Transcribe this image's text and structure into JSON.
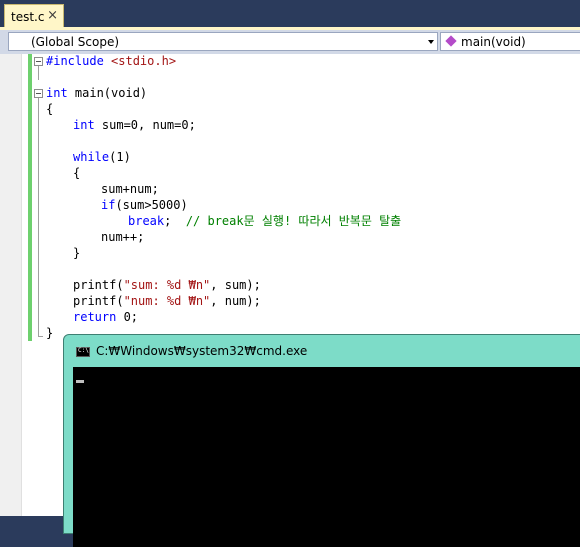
{
  "tab": {
    "label": "test.c",
    "close_glyph": "×"
  },
  "nav": {
    "scope": "(Global Scope)",
    "member": "main(void)"
  },
  "code": {
    "include_kw": "#include",
    "include_file": " <stdio.h>",
    "l4_kw": "int",
    "l4_rest": " main(void)",
    "brace_open": "{",
    "l6_kw": "int",
    "l6_rest": " sum=0, num=0;",
    "l8_kw": "while",
    "l8_rest": "(1)",
    "brace_open2": "{",
    "l10": "sum+num;",
    "l11_kw": "if",
    "l11_rest": "(sum>5000)",
    "l12_kw": "break",
    "l12_mid": ";  ",
    "l12_cmt": "// break문 실행! 따라서 반복문 탈출",
    "l13": "num++;",
    "brace_close2": "}",
    "l16_a": "printf(",
    "l16_str": "\"sum: %d ₩n\"",
    "l16_b": ", sum);",
    "l17_a": "printf(",
    "l17_str": "\"num: %d ₩n\"",
    "l17_b": ", num);",
    "l18_kw": "return",
    "l18_rest": " 0;",
    "brace_close": "}"
  },
  "console": {
    "title": "C:₩Windows₩system32₩cmd.exe"
  }
}
